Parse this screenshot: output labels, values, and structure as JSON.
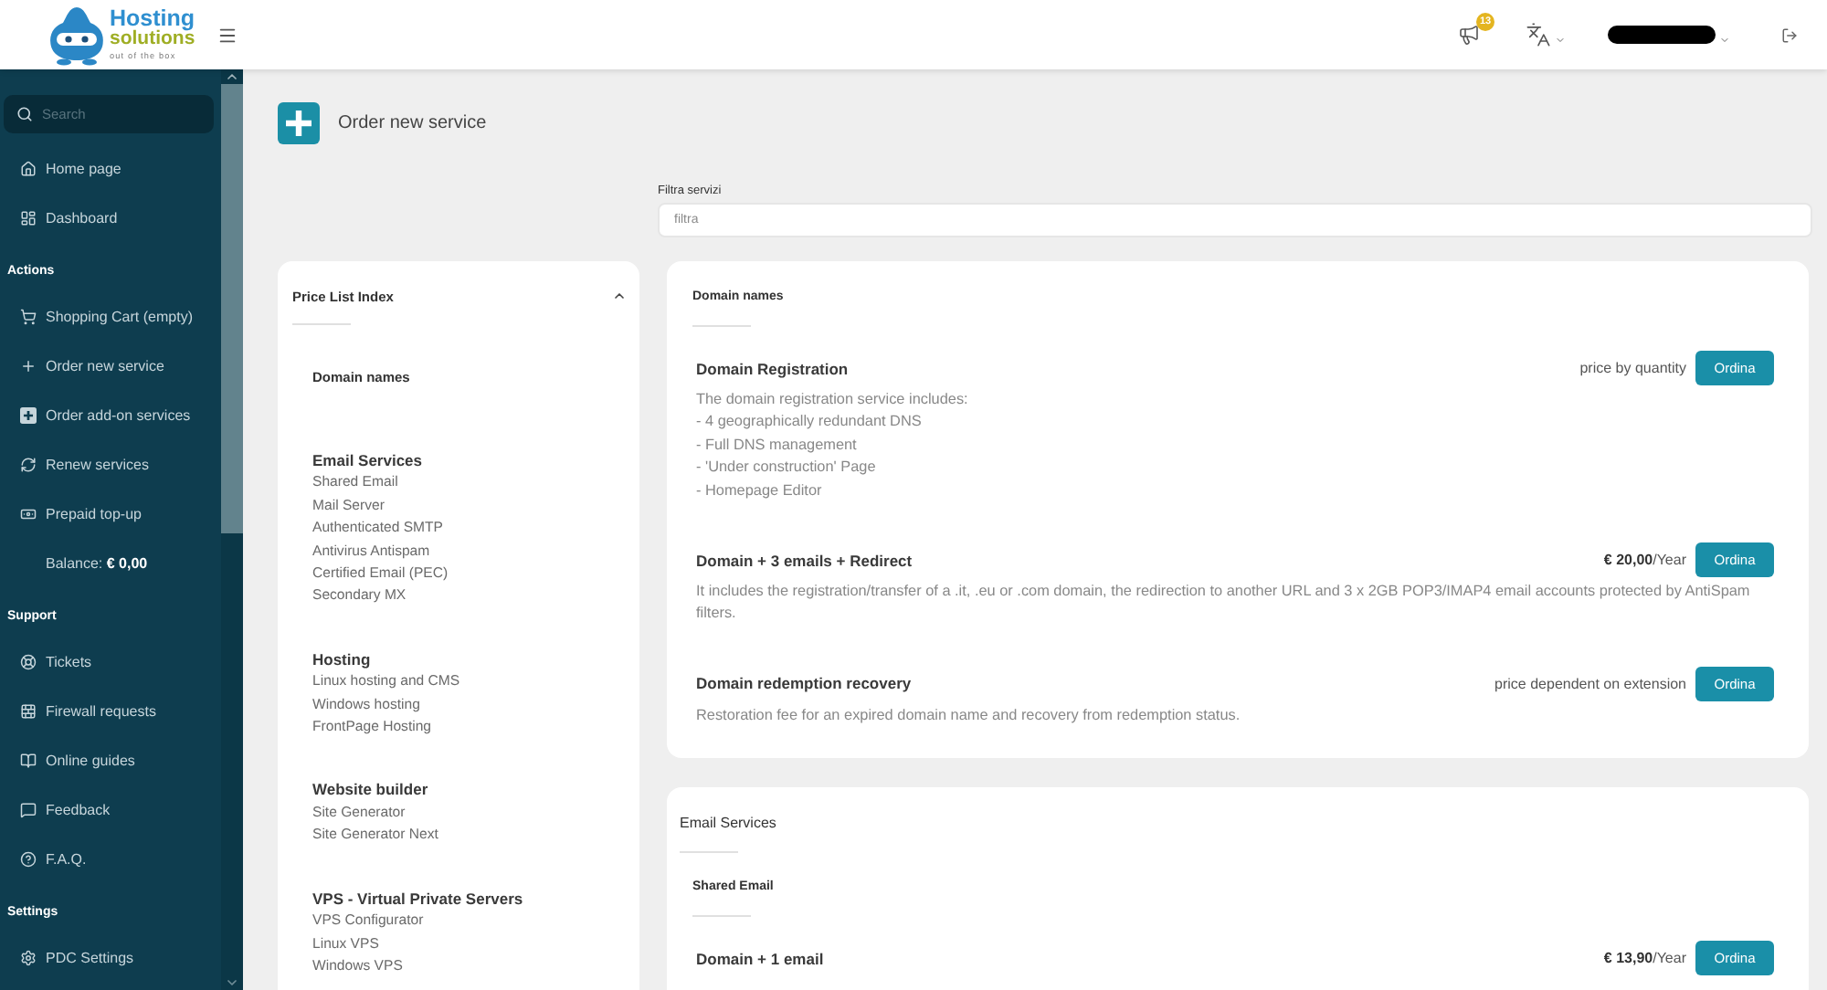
{
  "header": {
    "logo": {
      "line_1": "Hosting",
      "line_2": "solutions",
      "tagline": "out of the box"
    },
    "notifications": {
      "count": "13"
    }
  },
  "sidebar": {
    "search": {
      "placeholder": "Search"
    },
    "sections": [
      {
        "items": [
          {
            "kind": "link",
            "label": "Home page"
          },
          {
            "kind": "link",
            "label": "Dashboard"
          }
        ]
      },
      {
        "title": "Actions",
        "items": [
          {
            "kind": "link",
            "label": "Shopping Cart (empty)"
          },
          {
            "kind": "link",
            "label": "Order new service"
          },
          {
            "kind": "link",
            "label": "Order add-on services"
          },
          {
            "kind": "link",
            "label": "Renew services"
          },
          {
            "kind": "link",
            "label": "Prepaid top-up"
          },
          {
            "kind": "balance",
            "label": "Balance: **€ 0,00**"
          }
        ]
      },
      {
        "title": "Support",
        "items": [
          {
            "kind": "link",
            "label": "Tickets"
          },
          {
            "kind": "link",
            "label": "Firewall requests"
          },
          {
            "kind": "link",
            "label": "Online guides"
          },
          {
            "kind": "link",
            "label": "Feedback"
          },
          {
            "kind": "link",
            "label": "F.A.Q."
          }
        ]
      },
      {
        "title": "Settings",
        "items": [
          {
            "kind": "link",
            "label": "PDC Settings"
          }
        ]
      }
    ]
  },
  "page_title": "Order new service",
  "filter": {
    "label": "Filtra servizi",
    "placeholder": "filtra"
  },
  "price_list_index": {
    "title": "Price List Index",
    "expanded": true,
    "groups": [
      {
        "title": "Domain names"
      },
      {
        "title": "Email Services",
        "items": [
          "Shared Email",
          "Mail Server",
          "Authenticated SMTP",
          "Antivirus Antispam",
          "Certified Email (PEC)",
          "Secondary MX"
        ]
      },
      {
        "title": "Hosting",
        "items": [
          "Linux hosting and CMS",
          "Windows hosting",
          "FrontPage Hosting"
        ]
      },
      {
        "title": "Website builder",
        "items": [
          "Site Generator",
          "Site Generator Next"
        ]
      },
      {
        "title": "VPS - Virtual Private Servers",
        "items": [
          "VPS Configurator",
          "Linux VPS",
          "Windows VPS"
        ]
      }
    ]
  },
  "catalog": [
    {
      "subsections": [
        {
          "title": "Domain names",
          "products": [
            {
              "name": "Domain Registration",
              "price": "price by quantity",
              "button": "Ordina",
              "description": "The domain registration service includes:\n- 4 geographically redundant DNS\n- Full DNS management\n- 'Under construction' Page\n- Homepage Editor"
            },
            {
              "name": "Domain + 3 emails + Redirect",
              "price": "**€ 20,00**/Year",
              "button": "Ordina",
              "description": "It includes the registration/transfer of a .it, .eu or .com domain, the redirection to another URL and 3 x 2GB POP3/IMAP4 email accounts protected by AntiSpam filters."
            },
            {
              "name": "Domain redemption recovery",
              "price": "price dependent on extension",
              "button": "Ordina",
              "description": "Restoration fee for an expired domain name and recovery from redemption status."
            }
          ]
        }
      ]
    },
    {
      "title": "Email Services",
      "subsections": [
        {
          "title": "Shared Email",
          "products": [
            {
              "name": "Domain + 1 email",
              "price": "**€ 13,90**/Year",
              "button": "Ordina"
            }
          ]
        }
      ]
    }
  ]
}
